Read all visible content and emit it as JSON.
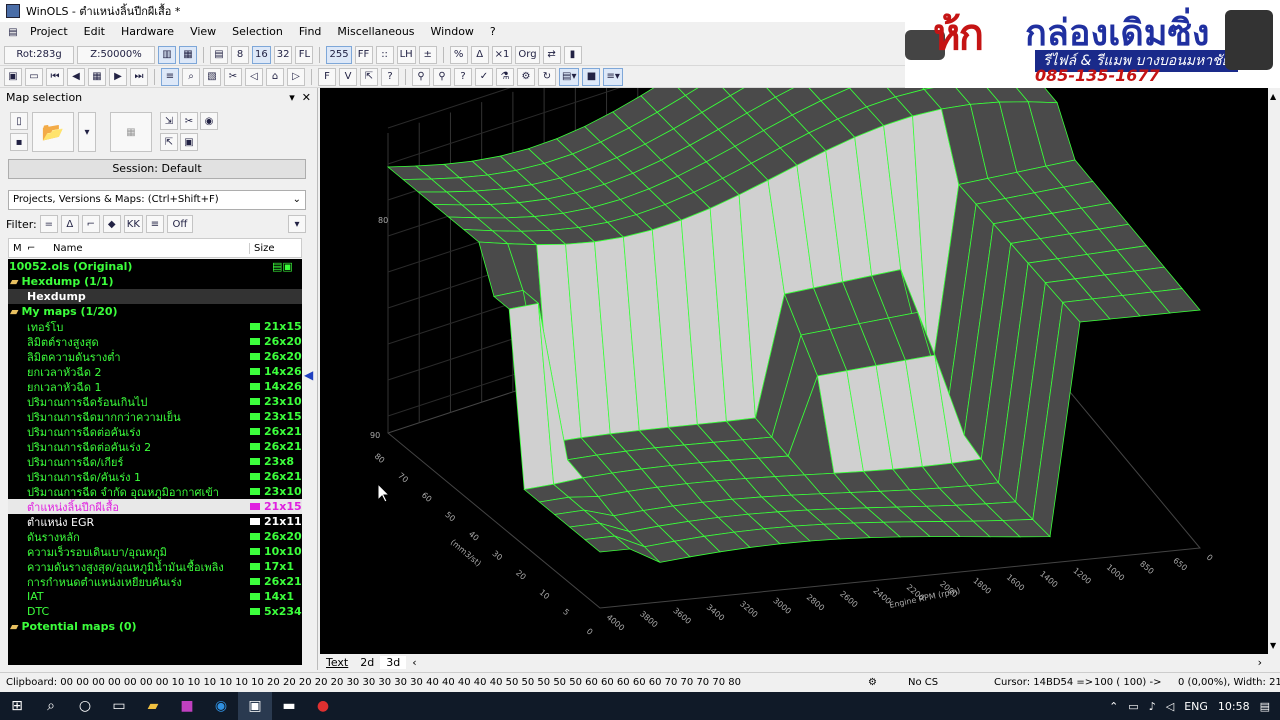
{
  "window": {
    "title": "WinOLS - ตำแหน่งลิ้นปีกผีเสื้อ *"
  },
  "menu": [
    "Project",
    "Edit",
    "Hardware",
    "View",
    "Selection",
    "Find",
    "Miscellaneous",
    "Window",
    "?"
  ],
  "toolbar": {
    "rot": "Rot:283g",
    "zoom": "Z:50000%"
  },
  "banner": {
    "text1": "ห้ก",
    "text2": "กล่องเดิมซิ่ง",
    "sub": "รีไฟล์ & รีแมพ บางบอนมหาชัย",
    "phone": "085-135-1677"
  },
  "panel": {
    "title": "Map selection",
    "session": "Session: Default",
    "search_placeholder": "Projects, Versions & Maps:  (Ctrl+Shift+F)",
    "filter_label": "Filter:",
    "filter_off": "Off",
    "col_m": "M",
    "col_name": "Name",
    "col_size": "Size"
  },
  "tree": {
    "project": "10052.ols (Original)",
    "hexdump_folder": "Hexdump (1/1)",
    "hexdump": "Hexdump",
    "mymaps": "My maps (1/20)",
    "potential": "Potential maps (0)"
  },
  "maps": [
    {
      "name": "เทอร์โบ",
      "size": "21x15",
      "style": "g"
    },
    {
      "name": "ลิมิตต์รางสูงสุด",
      "size": "26x20",
      "style": "g"
    },
    {
      "name": "ลิมิตความดันรางต่ำ",
      "size": "26x20",
      "style": "g"
    },
    {
      "name": "ยกเวลาหัวฉีด 2",
      "size": "14x26",
      "style": "g"
    },
    {
      "name": "ยกเวลาหัวฉีด 1",
      "size": "14x26",
      "style": "g"
    },
    {
      "name": "ปริมาณการฉีดร้อนเกินไป",
      "size": "23x10",
      "style": "g"
    },
    {
      "name": "ปริมาณการฉีดมากกว่าความเย็น",
      "size": "23x15",
      "style": "g"
    },
    {
      "name": "ปริมาณการฉีดต่อคันเร่ง",
      "size": "26x21",
      "style": "g"
    },
    {
      "name": "ปริมาณการฉีดต่อคันเร่ง 2",
      "size": "26x21",
      "style": "g"
    },
    {
      "name": "ปริมาณการฉีด/เกียร์",
      "size": "23x8",
      "style": "g"
    },
    {
      "name": "ปริมาณการฉีด/คันเร่ง 1",
      "size": "26x21",
      "style": "g"
    },
    {
      "name": "ปริมาณการฉีด จำกัด อุณหภูมิอากาศเข้า",
      "size": "23x10",
      "style": "g"
    },
    {
      "name": "ตำแหน่งลิ้นปีกผีเสื้อ",
      "size": "21x15",
      "style": "sel"
    },
    {
      "name": "ตำแหน่ง EGR",
      "size": "21x11",
      "style": "w"
    },
    {
      "name": "ดันรางหลัก",
      "size": "26x20",
      "style": "g"
    },
    {
      "name": "ความเร็วรอบเดินเบา/อุณหภูมิ",
      "size": "10x10",
      "style": "g"
    },
    {
      "name": "ความดันรางสูงสุด/อุณหภูมิน้ำมันเชื้อเพลิง",
      "size": "17x1",
      "style": "g"
    },
    {
      "name": "การกำหนดตำแหน่งเหยียบคันเร่ง",
      "size": "26x21",
      "style": "g"
    },
    {
      "name": "IAT",
      "size": "14x1",
      "style": "g"
    },
    {
      "name": "DTC",
      "size": "5x234",
      "style": "g"
    }
  ],
  "plot": {
    "z_labels": [
      "80",
      "90"
    ],
    "y_labels": [
      "80",
      "70",
      "60",
      "50",
      "40",
      "30",
      "20",
      "10",
      "5",
      "0"
    ],
    "y_axis": "(mm3/st)",
    "x_labels": [
      "4000",
      "3800",
      "3600",
      "3400",
      "3200",
      "3000",
      "2800",
      "2600",
      "2400",
      "2200",
      "2000",
      "1800",
      "1600",
      "1400",
      "1200",
      "1000",
      "850",
      "650",
      "0"
    ],
    "x_axis": "Engine RPM  (rpm)",
    "colors": {
      "mesh": "#39ff39",
      "light": "#d0d0d0",
      "dark": "#4a4a4a"
    }
  },
  "tabs": [
    "Text",
    "2d",
    "3d"
  ],
  "status": {
    "clipboard": "Clipboard: 00 00 00 00 00 00 00 10 10 10 10 10 10 20 20 20 20 20 30 30 30 30 30 40 40 40 40 40 50 50 50 50 50 60 60 60 60 60 70 70 70 70 80",
    "cs": "No CS",
    "cursor": "Cursor: 14BD54 =>",
    "value": "100 ( 100) ->",
    "extra": "0 (0,00%), Width: 21"
  },
  "taskbar": {
    "lang": "ENG",
    "time": "10:58"
  }
}
